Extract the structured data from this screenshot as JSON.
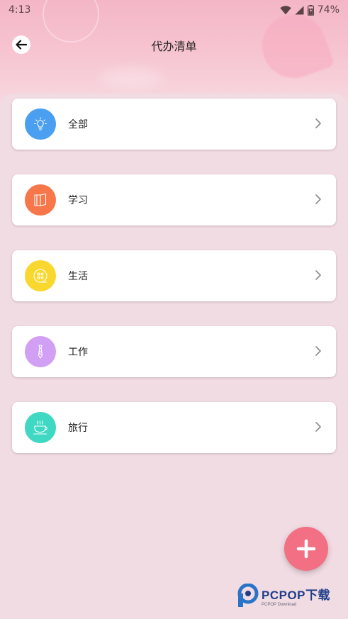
{
  "status_bar": {
    "time": "4:13",
    "battery": "74%"
  },
  "app_bar": {
    "title": "代办清单"
  },
  "categories": [
    {
      "label": "全部",
      "icon": "lightbulb-icon",
      "color": "#4a9ff0"
    },
    {
      "label": "学习",
      "icon": "book-icon",
      "color": "#f7764a"
    },
    {
      "label": "生活",
      "icon": "button-icon",
      "color": "#f8d82e"
    },
    {
      "label": "工作",
      "icon": "tie-icon",
      "color": "#d1a0f5"
    },
    {
      "label": "旅行",
      "icon": "coffee-cup-icon",
      "color": "#3fd8c3"
    }
  ],
  "fab": {
    "icon": "plus-icon",
    "color": "#f26f84"
  },
  "watermark": {
    "brand": "PCPOP下载",
    "sub": "PCPOP Download"
  }
}
